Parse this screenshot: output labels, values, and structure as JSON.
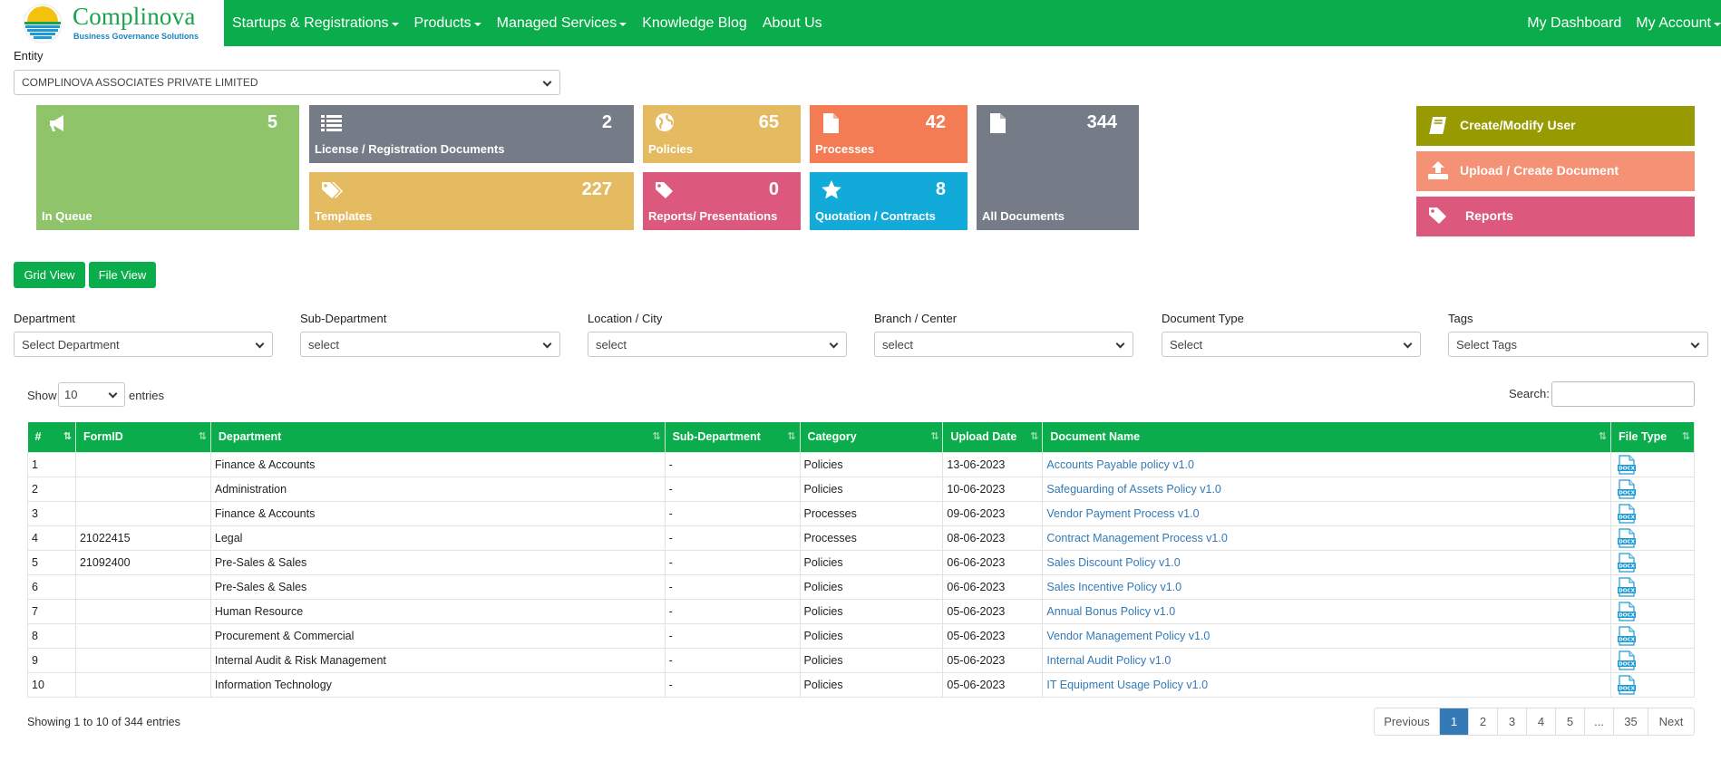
{
  "nav": {
    "brand": "Complinova",
    "tagline": "Business Governance Solutions",
    "menu": [
      "Startups & Registrations",
      "Products",
      "Managed Services",
      "Knowledge Blog",
      "About Us"
    ],
    "right": [
      "My Dashboard",
      "My Account"
    ]
  },
  "entity": {
    "label": "Entity",
    "value": "COMPLINOVA ASSOCIATES PRIVATE LIMITED"
  },
  "tiles": {
    "queue": {
      "count": "5",
      "label": "In Queue"
    },
    "license": {
      "count": "2",
      "label": "License / Registration Documents"
    },
    "policies": {
      "count": "65",
      "label": "Policies"
    },
    "processes": {
      "count": "42",
      "label": "Processes"
    },
    "all": {
      "count": "344",
      "label": "All Documents"
    },
    "templates": {
      "count": "227",
      "label": "Templates"
    },
    "reports": {
      "count": "0",
      "label": "Reports/ Presentations"
    },
    "quotation": {
      "count": "8",
      "label": "Quotation / Contracts"
    }
  },
  "actions": {
    "create_user": "Create/Modify User",
    "upload": "Upload / Create Document",
    "reports": "Reports"
  },
  "views": {
    "grid": "Grid View",
    "file": "File View"
  },
  "filters": [
    {
      "label": "Department",
      "value": "Select Department"
    },
    {
      "label": "Sub-Department",
      "value": "select"
    },
    {
      "label": "Location / City",
      "value": "select"
    },
    {
      "label": "Branch / Center",
      "value": "select"
    },
    {
      "label": "Document Type",
      "value": "Select"
    },
    {
      "label": "Tags",
      "value": "Select Tags"
    }
  ],
  "table_controls": {
    "show": "Show",
    "page_size": "10",
    "entries": "entries",
    "search": "Search:"
  },
  "columns": [
    "#",
    "FormID",
    "Department",
    "Sub-Department",
    "Category",
    "Upload Date",
    "Document Name",
    "File Type"
  ],
  "rows": [
    {
      "n": "1",
      "form": "",
      "dept": "Finance & Accounts",
      "sub": "-",
      "cat": "Policies",
      "date": "13-06-2023",
      "name": "Accounts Payable policy v1.0"
    },
    {
      "n": "2",
      "form": "",
      "dept": "Administration",
      "sub": "-",
      "cat": "Policies",
      "date": "10-06-2023",
      "name": "Safeguarding of Assets Policy v1.0"
    },
    {
      "n": "3",
      "form": "",
      "dept": "Finance & Accounts",
      "sub": "-",
      "cat": "Processes",
      "date": "09-06-2023",
      "name": "Vendor Payment Process v1.0"
    },
    {
      "n": "4",
      "form": "21022415",
      "dept": "Legal",
      "sub": "-",
      "cat": "Processes",
      "date": "08-06-2023",
      "name": "Contract Management Process v1.0"
    },
    {
      "n": "5",
      "form": "21092400",
      "dept": "Pre-Sales & Sales",
      "sub": "-",
      "cat": "Policies",
      "date": "06-06-2023",
      "name": "Sales Discount Policy v1.0"
    },
    {
      "n": "6",
      "form": "",
      "dept": "Pre-Sales & Sales",
      "sub": "-",
      "cat": "Policies",
      "date": "06-06-2023",
      "name": "Sales Incentive Policy v1.0"
    },
    {
      "n": "7",
      "form": "",
      "dept": "Human Resource",
      "sub": "-",
      "cat": "Policies",
      "date": "05-06-2023",
      "name": "Annual Bonus Policy v1.0"
    },
    {
      "n": "8",
      "form": "",
      "dept": "Procurement & Commercial",
      "sub": "-",
      "cat": "Policies",
      "date": "05-06-2023",
      "name": "Vendor Management Policy v1.0"
    },
    {
      "n": "9",
      "form": "",
      "dept": "Internal Audit & Risk Management",
      "sub": "-",
      "cat": "Policies",
      "date": "05-06-2023",
      "name": "Internal Audit Policy v1.0"
    },
    {
      "n": "10",
      "form": "",
      "dept": "Information Technology",
      "sub": "-",
      "cat": "Policies",
      "date": "05-06-2023",
      "name": "IT Equipment Usage Policy v1.0"
    }
  ],
  "file_icon_text": "DOCX",
  "footer": {
    "showing": "Showing 1 to 10 of 344 entries",
    "pages": [
      "Previous",
      "1",
      "2",
      "3",
      "4",
      "5",
      "...",
      "35",
      "Next"
    ],
    "active_page": "1"
  },
  "colors": {
    "brand_green": "#0aac4c",
    "tile_green": "#8fc46a",
    "tile_gray": "#757c87",
    "tile_yellow": "#e5bb61",
    "tile_orange": "#f47c55",
    "tile_pink": "#dc587c",
    "tile_cyan": "#11aad9",
    "olive": "#979a00",
    "salmon": "#f59174",
    "link": "#337ab7"
  }
}
